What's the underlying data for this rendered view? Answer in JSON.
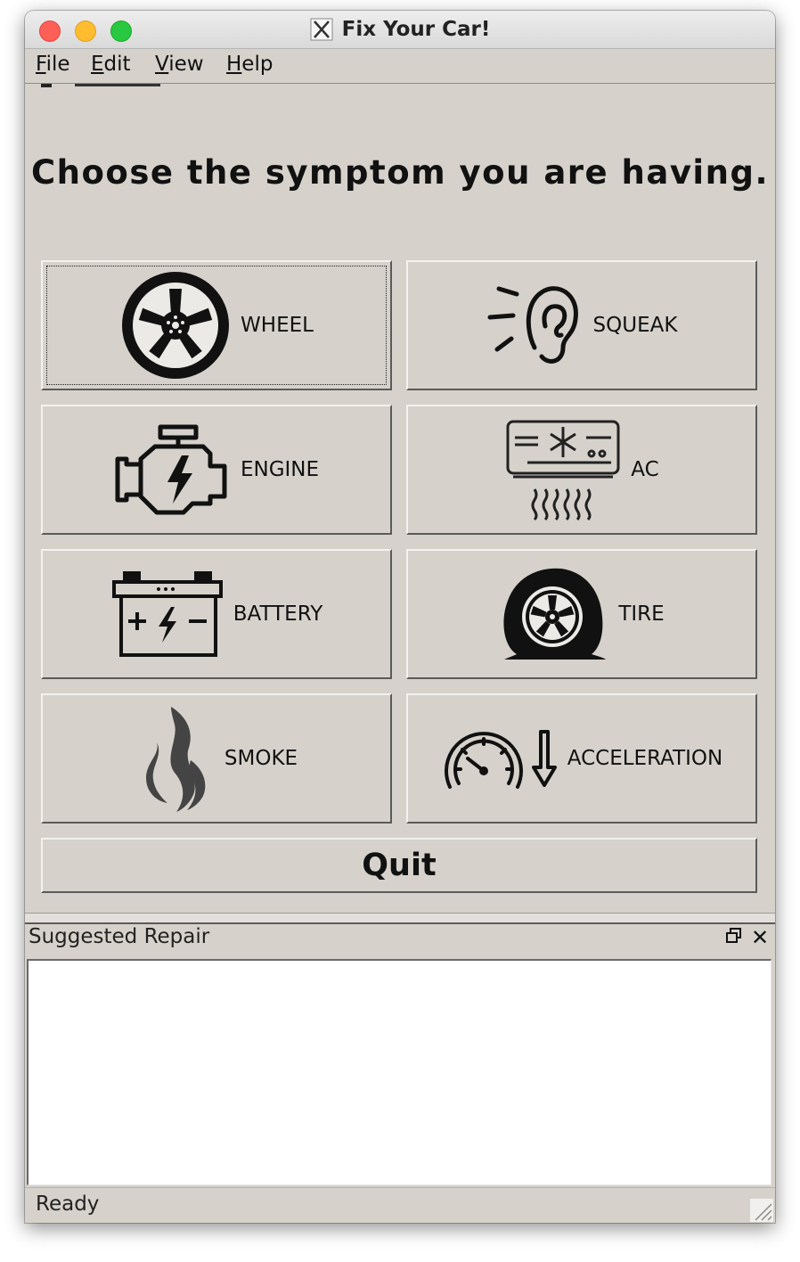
{
  "window": {
    "title": "Fix Your Car!"
  },
  "menubar": {
    "items": [
      {
        "mnemonic": "F",
        "rest": "ile"
      },
      {
        "mnemonic": "E",
        "rest": "dit"
      },
      {
        "mnemonic": "V",
        "rest": "iew"
      },
      {
        "mnemonic": "H",
        "rest": "elp"
      }
    ]
  },
  "main": {
    "heading": "Choose the symptom you are having.",
    "symptoms": [
      {
        "label": "WHEEL",
        "icon": "wheel-icon"
      },
      {
        "label": "SQUEAK",
        "icon": "ear-icon"
      },
      {
        "label": "ENGINE",
        "icon": "engine-icon"
      },
      {
        "label": "AC",
        "icon": "air-conditioner-icon"
      },
      {
        "label": "BATTERY",
        "icon": "battery-icon"
      },
      {
        "label": "TIRE",
        "icon": "flat-tire-icon"
      },
      {
        "label": "SMOKE",
        "icon": "smoke-icon"
      },
      {
        "label": "ACCELERATION",
        "icon": "speedometer-down-icon"
      }
    ],
    "quit_label": "Quit"
  },
  "dock": {
    "title": "Suggested Repair",
    "content": ""
  },
  "status": {
    "text": "Ready"
  },
  "colors": {
    "window_bg": "#d6d2cb",
    "traffic_red": "#fe5f57",
    "traffic_yellow": "#febc2e",
    "traffic_green": "#28c840"
  }
}
